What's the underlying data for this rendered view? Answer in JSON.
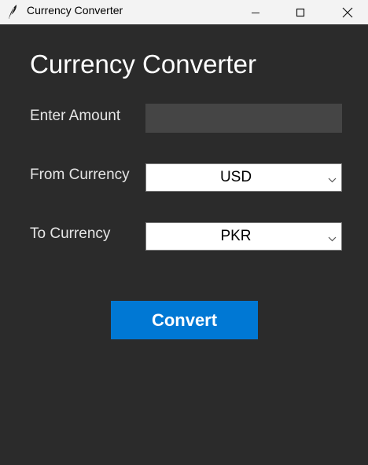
{
  "window": {
    "title": "Currency Converter",
    "icon": "feather-icon",
    "controls": [
      "minimize-icon",
      "maximize-icon",
      "close-icon"
    ]
  },
  "main": {
    "heading": "Currency Converter",
    "amount_label": "Enter Amount",
    "amount_value": "",
    "from_label": "From Currency",
    "from_selected": "USD",
    "to_label": "To Currency",
    "to_selected": "PKR",
    "convert_label": "Convert"
  },
  "colors": {
    "background": "#2b2b2b",
    "titlebar": "#f3f3f3",
    "input_bg": "#454545",
    "accent": "#0078d4"
  }
}
